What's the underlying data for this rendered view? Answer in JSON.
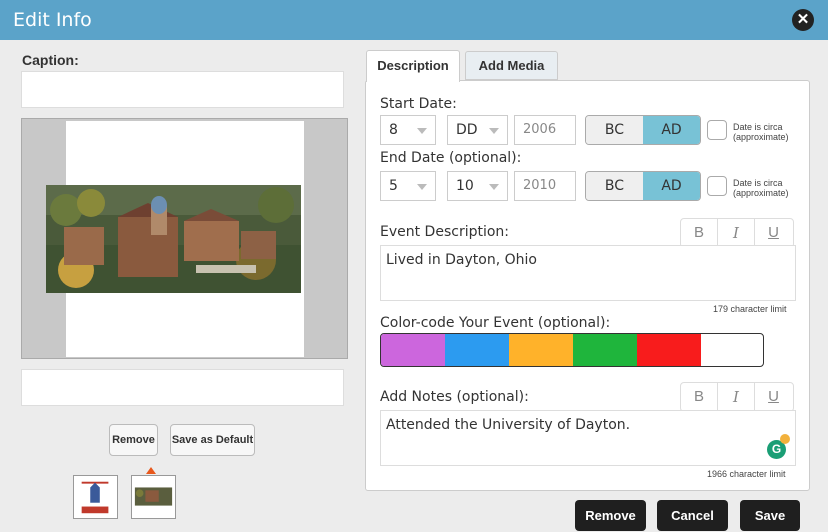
{
  "window": {
    "title": "Edit Info"
  },
  "left": {
    "caption_label": "Caption:",
    "remove_label": "Remove",
    "save_default_label": "Save as Default"
  },
  "tabs": {
    "description": "Description",
    "add_media": "Add Media"
  },
  "start": {
    "label": "Start Date:",
    "month": "8",
    "day": "DD",
    "year_placeholder": "2006",
    "era_bc": "BC",
    "era_ad": "AD",
    "era_selected": "AD",
    "circa_line1": "Date is circa",
    "circa_line2": "(approximate)"
  },
  "end": {
    "label": "End Date (optional):",
    "month": "5",
    "day": "10",
    "year_placeholder": "2010",
    "era_bc": "BC",
    "era_ad": "AD",
    "era_selected": "AD",
    "circa_line1": "Date is circa",
    "circa_line2": "(approximate)"
  },
  "event": {
    "label": "Event Description:",
    "text": "Lived in Dayton, Ohio",
    "limit": "179 character limit"
  },
  "format": {
    "bold": "B",
    "italic": "I",
    "underline": "U"
  },
  "color": {
    "label": "Color-code Your Event (optional):",
    "swatches": [
      "#cc66dd",
      "#2c9bf0",
      "#ffb22a",
      "#1fb53c",
      "#f81c1c",
      "#ffffff"
    ],
    "selected_mark": "✔"
  },
  "notes": {
    "label": "Add Notes (optional):",
    "text": "Attended the University of Dayton.",
    "limit": "1966 character limit"
  },
  "footer": {
    "remove": "Remove",
    "cancel": "Cancel",
    "save": "Save"
  },
  "icons": {
    "close": "close-icon",
    "grammarly": "grammarly-icon",
    "grammarly_letter": "G",
    "close_glyph": "✕"
  }
}
